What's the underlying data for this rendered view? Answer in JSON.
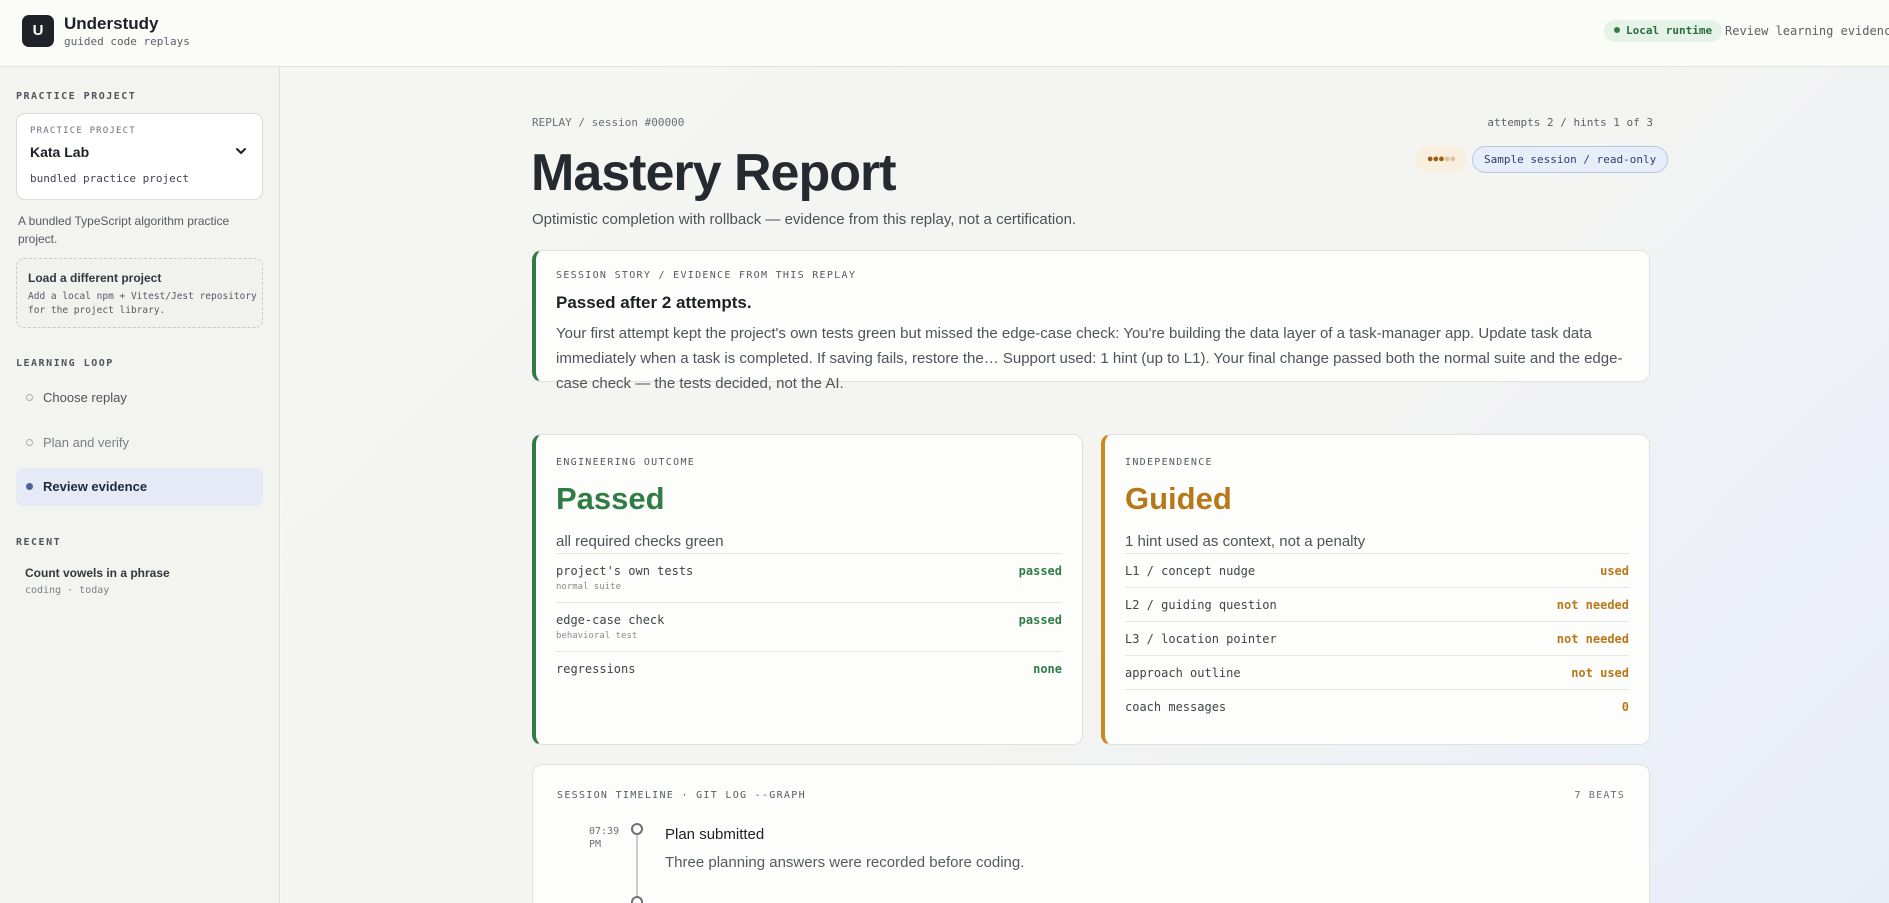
{
  "header": {
    "logo_letter": "U",
    "brand_name": "Understudy",
    "brand_sub": "guided code replays",
    "runtime_badge": "Local runtime",
    "nav_link": "Review learning evidence"
  },
  "sidebar": {
    "practice_heading": "PRACTICE PROJECT",
    "project_card": {
      "label": "PRACTICE PROJECT",
      "name": "Kata Lab",
      "description": "bundled practice project"
    },
    "project_description": "A bundled TypeScript algorithm practice project.",
    "load_card": {
      "title": "Load a different project",
      "description": "Add a local npm + Vitest/Jest repository for the project library."
    },
    "learning_heading": "LEARNING LOOP",
    "loop_items": [
      {
        "label": "Choose replay",
        "state": "default"
      },
      {
        "label": "Plan and verify",
        "state": "dim"
      },
      {
        "label": "Review evidence",
        "state": "active"
      }
    ],
    "recent_heading": "RECENT",
    "recent": {
      "title": "Count vowels in a phrase",
      "meta": "coding · today"
    }
  },
  "main": {
    "breadcrumb": "REPLAY / session #00000",
    "attempts": "attempts 2 / hints 1 of 3",
    "title": "Mastery Report",
    "subtitle": "Optimistic completion with rollback — evidence from this replay, not a certification.",
    "hint_dots": {
      "used": 3,
      "total": 5
    },
    "sample_badge": "Sample session / read-only",
    "story": {
      "eyebrow": "SESSION STORY / EVIDENCE FROM THIS REPLAY",
      "headline": "Passed after 2 attempts.",
      "body": "Your first attempt kept the project's own tests green but missed the edge-case check: You're building the data layer of a task-manager app. Update task data immediately when a task is completed. If saving fails, restore the… Support used: 1 hint (up to L1). Your final change passed both the normal suite and the edge-case check — the tests decided, not the AI."
    },
    "outcome": {
      "eyebrow": "ENGINEERING OUTCOME",
      "status": "Passed",
      "summary": "all required checks green",
      "rows": [
        {
          "label": "project's own tests",
          "note": "normal suite",
          "value": "passed"
        },
        {
          "label": "edge-case check",
          "note": "behavioral test",
          "value": "passed"
        },
        {
          "label": "regressions",
          "note": "",
          "value": "none"
        }
      ]
    },
    "independence": {
      "eyebrow": "INDEPENDENCE",
      "status": "Guided",
      "summary": "1 hint used as context, not a penalty",
      "rows": [
        {
          "label": "L1 / concept nudge",
          "value": "used"
        },
        {
          "label": "L2 / guiding question",
          "value": "not needed"
        },
        {
          "label": "L3 / location pointer",
          "value": "not needed"
        },
        {
          "label": "approach outline",
          "value": "not used"
        },
        {
          "label": "coach messages",
          "value": "0"
        }
      ]
    },
    "timeline": {
      "eyebrow": "SESSION TIMELINE · GIT LOG --GRAPH",
      "count": "7 BEATS",
      "events": [
        {
          "time": "07:39 PM",
          "title": "Plan submitted",
          "description": "Three planning answers were recorded before coding."
        }
      ]
    }
  },
  "colors": {
    "pass_green": "#2f7d45",
    "guided_amber": "#b7781a",
    "accent_blue": "#4a6496"
  }
}
